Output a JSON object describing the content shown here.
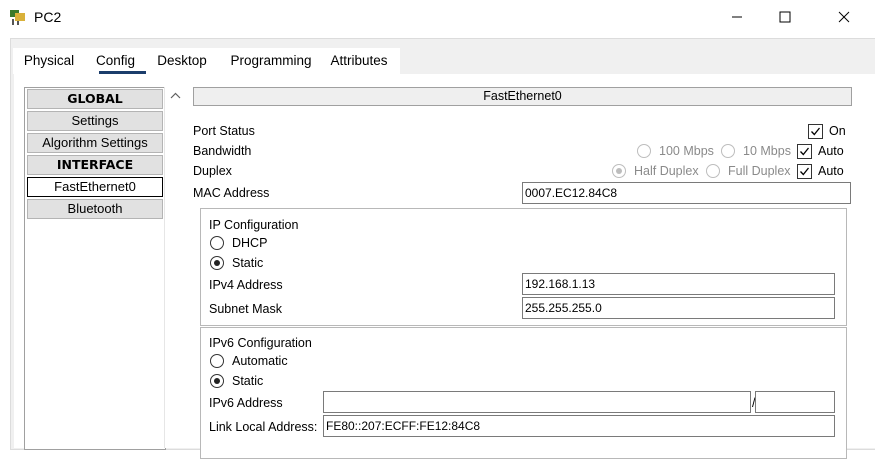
{
  "window": {
    "title": "PC2"
  },
  "tabs": [
    {
      "label": "Physical"
    },
    {
      "label": "Config"
    },
    {
      "label": "Desktop"
    },
    {
      "label": "Programming"
    },
    {
      "label": "Attributes"
    }
  ],
  "sidebar": {
    "items": [
      {
        "label": "GLOBAL"
      },
      {
        "label": "Settings"
      },
      {
        "label": "Algorithm Settings"
      },
      {
        "label": "INTERFACE"
      },
      {
        "label": "FastEthernet0"
      },
      {
        "label": "Bluetooth"
      }
    ]
  },
  "panel": {
    "title": "FastEthernet0",
    "port_status_label": "Port Status",
    "on_label": "On",
    "bandwidth_label": "Bandwidth",
    "bw_100": "100 Mbps",
    "bw_10": "10 Mbps",
    "bw_auto": "Auto",
    "duplex_label": "Duplex",
    "dup_half": "Half Duplex",
    "dup_full": "Full Duplex",
    "dup_auto": "Auto",
    "mac_label": "MAC Address",
    "mac_value": "0007.EC12.84C8",
    "ipconf": {
      "title": "IP Configuration",
      "dhcp": "DHCP",
      "static": "Static",
      "ipv4_label": "IPv4 Address",
      "ipv4_value": "192.168.1.13",
      "mask_label": "Subnet Mask",
      "mask_value": "255.255.255.0"
    },
    "ipv6conf": {
      "title": "IPv6 Configuration",
      "automatic": "Automatic",
      "static": "Static",
      "ipv6_label": "IPv6 Address",
      "ipv6_value": "",
      "slash": "/",
      "prefix_value": "",
      "link_local_label": "Link Local Address:",
      "link_local_value": "FE80::207:ECFF:FE12:84C8"
    }
  }
}
